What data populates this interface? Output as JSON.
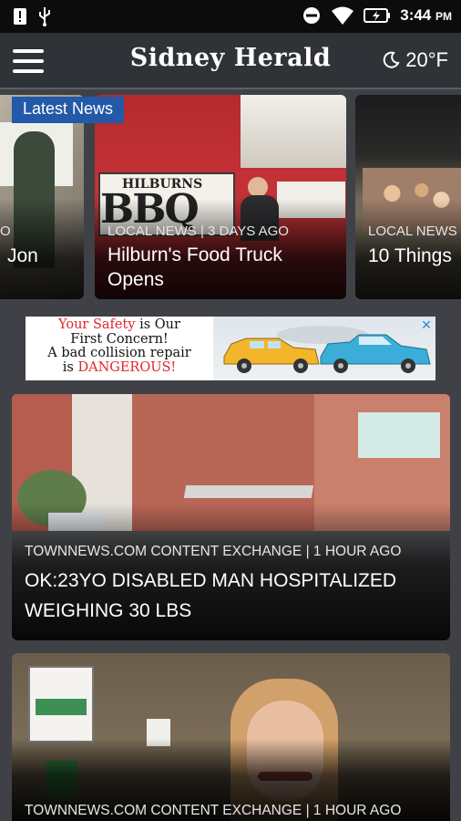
{
  "status": {
    "time": "3:44",
    "ampm": "PM"
  },
  "header": {
    "brand": "Sidney Herald",
    "temperature": "20°F"
  },
  "carousel": {
    "badge": "Latest News",
    "cards": [
      {
        "meta": "O",
        "headline": "Jon"
      },
      {
        "meta": "LOCAL NEWS | 3 DAYS AGO",
        "headline": "Hilburn's Food Truck Opens",
        "sign": "HILBURNS",
        "sign2": "BBQ"
      },
      {
        "meta": "LOCAL NEWS",
        "headline": "10 Things"
      }
    ]
  },
  "ad": {
    "line1_red": "Your Safety",
    "line1_rest": " is Our",
    "line2": "First Concern!",
    "line3": "A bad collision repair",
    "line4_a": "is ",
    "line4_red": "DANGEROUS!",
    "close": "✕"
  },
  "stories": [
    {
      "meta": "TOWNNEWS.COM CONTENT EXCHANGE | 1 HOUR AGO",
      "headline": "OK:23YO DISABLED MAN HOSPITALIZED WEIGHING 30 LBS"
    },
    {
      "meta": "TOWNNEWS.COM CONTENT EXCHANGE | 1 HOUR AGO",
      "headline": ""
    }
  ],
  "colors": {
    "accent": "#2359a8",
    "appbar": "#2f3237",
    "background": "#3f4147"
  }
}
